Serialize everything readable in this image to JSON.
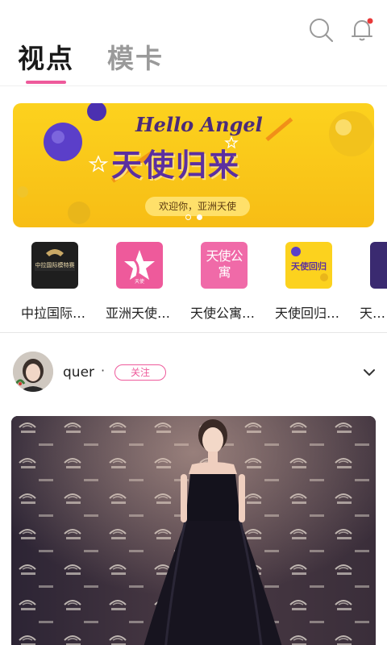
{
  "header": {
    "tabs": [
      {
        "label": "视点",
        "active": true
      },
      {
        "label": "模卡",
        "active": false
      }
    ],
    "icons": [
      "search-icon",
      "bell-icon"
    ],
    "accent_color": "#ee5a9b",
    "notification_dot_color": "#e83a3a"
  },
  "banner": {
    "script_text": "Hello Angel",
    "title": "天使归来",
    "subtitle": "欢迎你，亚洲天使",
    "page_count": 2,
    "current_page": 2,
    "background_color": "#fcd21e"
  },
  "channels": [
    {
      "label": "中拉国际…",
      "thumb_text": "中拉国际模特赛",
      "thumb_color": "#1e1e1e"
    },
    {
      "label": "亚洲天使…",
      "thumb_text": "天使",
      "thumb_color": "#ee5a9b"
    },
    {
      "label": "天使公寓…",
      "thumb_text": "天使公寓",
      "thumb_color": "#f06aa8"
    },
    {
      "label": "天使回归…",
      "thumb_text": "天使回归",
      "thumb_color": "#fcd21e"
    },
    {
      "label": "天…",
      "thumb_text": "",
      "thumb_color": "#3a2a70"
    }
  ],
  "post": {
    "username": "quer",
    "separator": "·",
    "follow_label": "关注",
    "backdrop_brands": [
      "CHINA LATVIA",
      "Hello Angel"
    ]
  }
}
